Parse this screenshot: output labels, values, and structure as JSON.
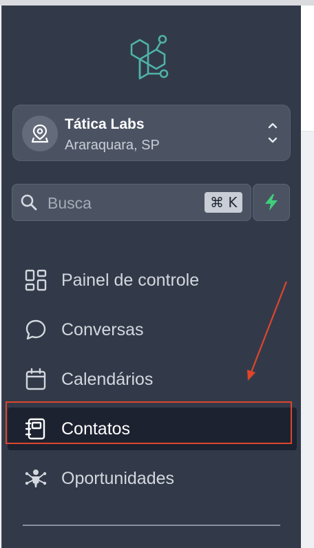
{
  "colors": {
    "sidebar_bg": "#323a49",
    "card_bg": "#4b5363",
    "active_bg": "#1c2230",
    "logo_teal": "#4fb3a8",
    "bolt_green": "#3ecf7a",
    "annotation_red": "#e0452c"
  },
  "logo": {
    "icon": "hexagon-network-logo"
  },
  "location": {
    "name": "Tática Labs",
    "city": "Araraquara, SP",
    "icon": "map-pin-icon",
    "switch_icon": "chevron-up-down-icon"
  },
  "search": {
    "placeholder": "Busca",
    "shortcut": "⌘ K",
    "icon": "search-icon"
  },
  "quick_action": {
    "icon": "lightning-bolt-icon"
  },
  "nav": {
    "items": [
      {
        "label": "Painel de controle",
        "icon": "dashboard-grid-icon",
        "active": false
      },
      {
        "label": "Conversas",
        "icon": "chat-bubble-icon",
        "active": false
      },
      {
        "label": "Calendários",
        "icon": "calendar-icon",
        "active": false
      },
      {
        "label": "Contatos",
        "icon": "contacts-book-icon",
        "active": true
      },
      {
        "label": "Oportunidades",
        "icon": "opportunities-network-icon",
        "active": false
      }
    ]
  },
  "annotation": {
    "type": "arrow-and-box",
    "target": "Contatos"
  }
}
